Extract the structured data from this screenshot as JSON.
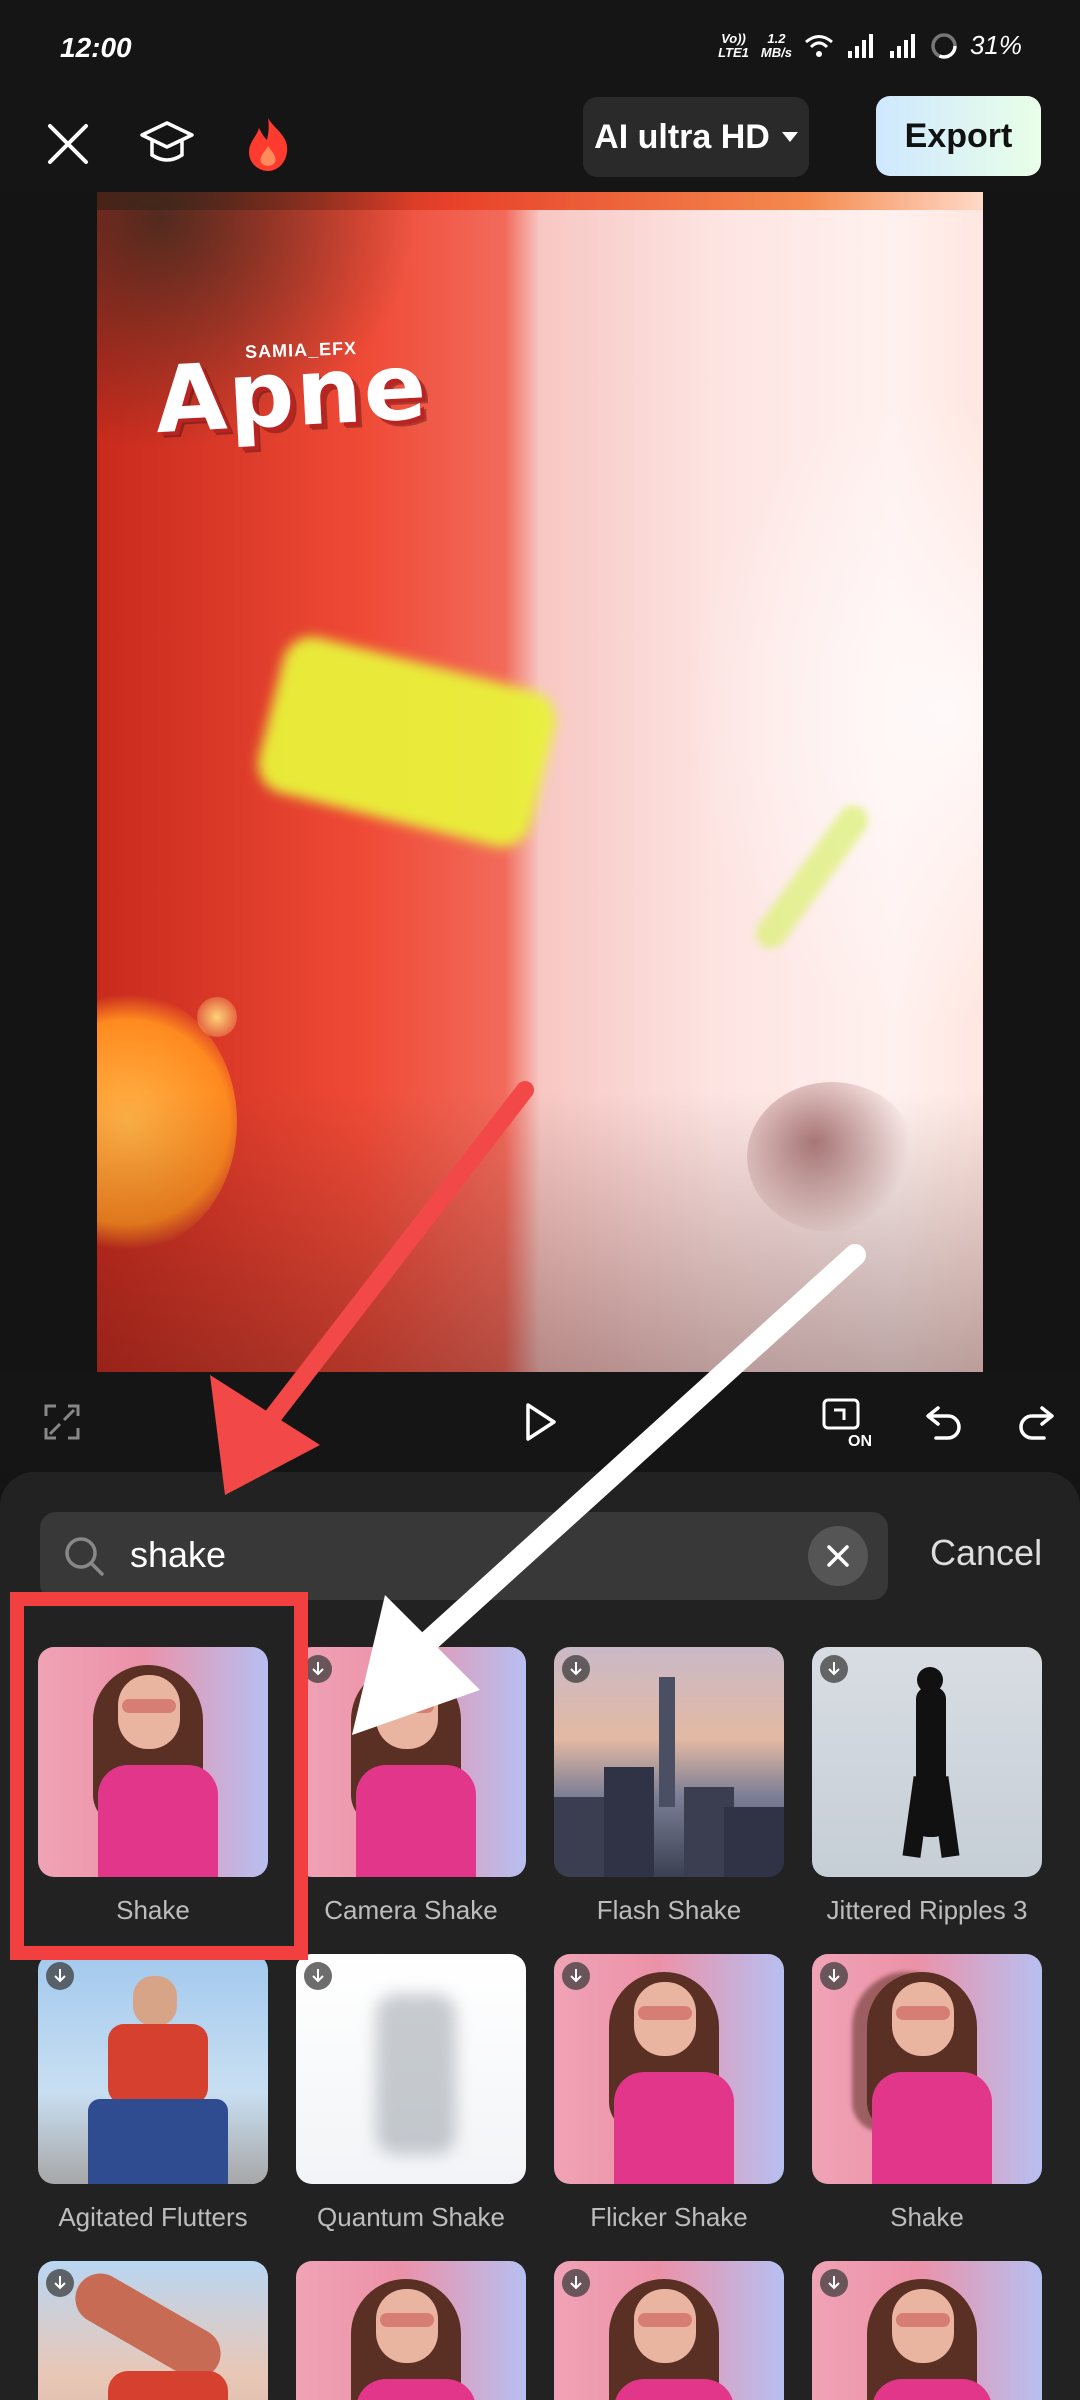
{
  "status_bar": {
    "time": "12:00",
    "net_type_top": "Vo))",
    "net_type_bottom": "LTE1",
    "speed_top": "1.2",
    "speed_bottom": "MB/s",
    "battery": "31%"
  },
  "toolbar": {
    "resolution_label": "AI ultra HD",
    "export_label": "Export"
  },
  "preview": {
    "logo_small": "SAMIA_EFX",
    "logo_text": "Apne"
  },
  "playback": {
    "preview_on_label": "ON"
  },
  "search": {
    "query": "shake",
    "cancel_label": "Cancel"
  },
  "effects": [
    {
      "label": "Shake"
    },
    {
      "label": "Camera Shake"
    },
    {
      "label": "Flash Shake"
    },
    {
      "label": "Jittered Ripples 3"
    },
    {
      "label": "Agitated Flutters"
    },
    {
      "label": "Quantum Shake"
    },
    {
      "label": "Flicker Shake"
    },
    {
      "label": "Shake"
    }
  ],
  "colors": {
    "highlight": "#f24040",
    "export_gradient_start": "#cfe8ff",
    "export_gradient_end": "#e9ffe8",
    "flame": "#ff3b30"
  }
}
